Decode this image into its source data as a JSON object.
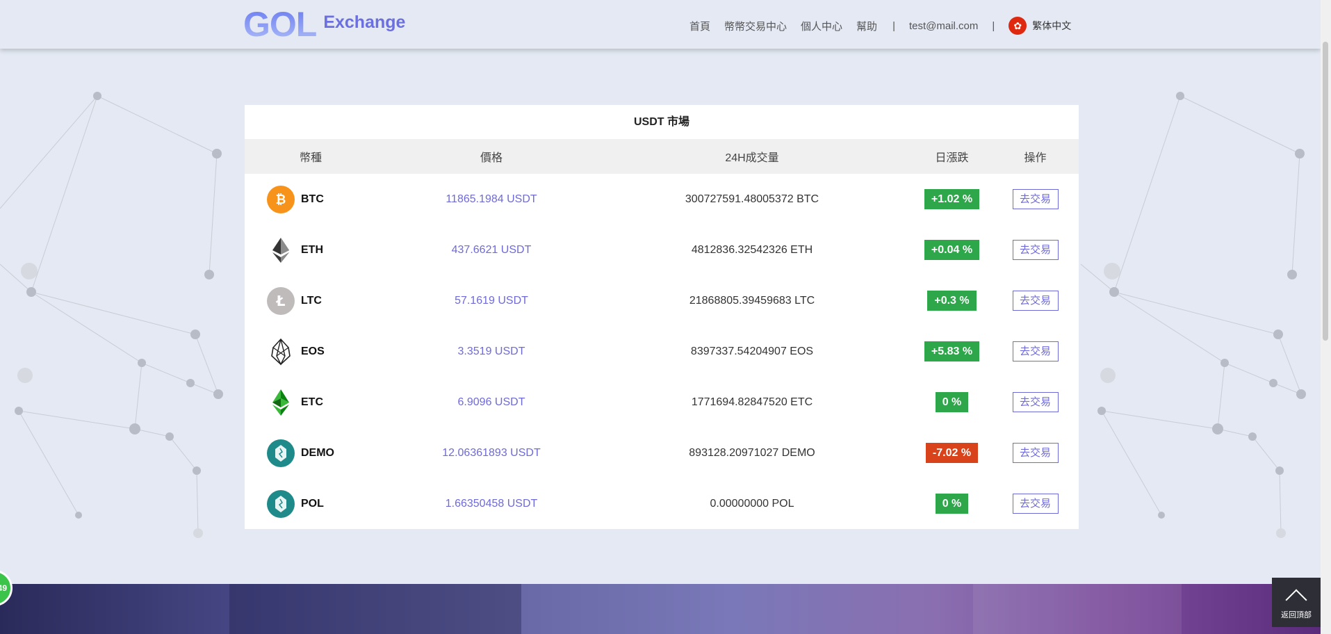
{
  "header": {
    "logo_main": "GOL",
    "logo_sub": "Exchange",
    "nav": [
      "首頁",
      "幣幣交易中心",
      "個人中心",
      "幫助"
    ],
    "separator": "|",
    "email": "test@mail.com",
    "language": "繁体中文"
  },
  "market": {
    "title": "USDT 市場",
    "columns": [
      "幣種",
      "價格",
      "24H成交量",
      "日漲跌",
      "操作"
    ],
    "rows": [
      {
        "coin": "BTC",
        "icon": "bitcoin-icon",
        "price": "11865.1984 USDT",
        "volume": "300727591.48005372 BTC",
        "change": "+1.02 %",
        "direction": "up",
        "action": "去交易"
      },
      {
        "coin": "ETH",
        "icon": "ethereum-icon",
        "price": "437.6621 USDT",
        "volume": "4812836.32542326 ETH",
        "change": "+0.04 %",
        "direction": "up",
        "action": "去交易"
      },
      {
        "coin": "LTC",
        "icon": "litecoin-icon",
        "price": "57.1619 USDT",
        "volume": "21868805.39459683 LTC",
        "change": "+0.3 %",
        "direction": "up",
        "action": "去交易"
      },
      {
        "coin": "EOS",
        "icon": "eos-icon",
        "price": "3.3519 USDT",
        "volume": "8397337.54204907 EOS",
        "change": "+5.83 %",
        "direction": "up",
        "action": "去交易"
      },
      {
        "coin": "ETC",
        "icon": "ethereum-classic-icon",
        "price": "6.9096 USDT",
        "volume": "1771694.82847520 ETC",
        "change": "0 %",
        "direction": "up",
        "action": "去交易"
      },
      {
        "coin": "DEMO",
        "icon": "demo-coin-icon",
        "price": "12.06361893 USDT",
        "volume": "893128.20971027 DEMO",
        "change": "-7.02 %",
        "direction": "down",
        "action": "去交易"
      },
      {
        "coin": "POL",
        "icon": "pol-coin-icon",
        "price": "1.66350458 USDT",
        "volume": "0.00000000 POL",
        "change": "0 %",
        "direction": "up",
        "action": "去交易"
      }
    ]
  },
  "back_to_top": "返回頂部",
  "bubble_text": "49",
  "colors": {
    "accent": "#6e6ad8",
    "up": "#2ea64a",
    "down": "#d9431c",
    "page_bg": "#e4e9f3"
  }
}
